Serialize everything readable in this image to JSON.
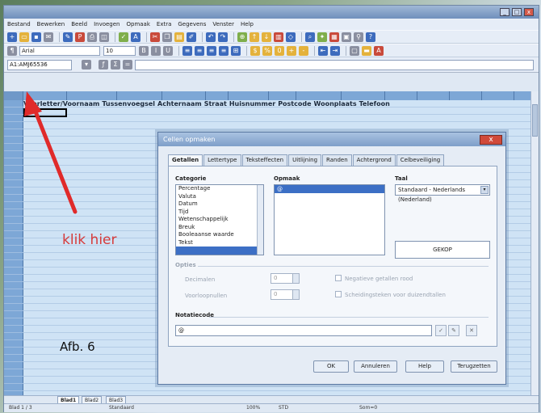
{
  "window": {
    "title": "",
    "controls": [
      "_",
      "□",
      "x"
    ]
  },
  "menu": {
    "items": [
      "Bestand",
      "Bewerken",
      "Beeld",
      "Invoegen",
      "Opmaak",
      "Extra",
      "Gegevens",
      "Venster",
      "Help"
    ]
  },
  "toolbar": {
    "font_name": "Arial",
    "font_size": "10"
  },
  "formula": {
    "name_box": "A1:AMJ65536"
  },
  "sheet": {
    "headers": [
      "Voorletter/Voornaam",
      "Tussenvoegsel",
      "Achternaam",
      "Straat",
      "Huisnummer",
      "Postcode",
      "Woonplaats",
      "Telefoon"
    ]
  },
  "annotation": {
    "click_label": "klik hier",
    "figure_label": "Afb. 6",
    "arrow_color": "#e02a2a"
  },
  "dialog": {
    "title": "Cellen opmaken",
    "tabs": [
      "Getallen",
      "Lettertype",
      "Teksteffecten",
      "Uitlijning",
      "Randen",
      "Achtergrond",
      "Celbeveiliging"
    ],
    "categorie_label": "Categorie",
    "categories": [
      "Percentage",
      "Valuta",
      "Datum",
      "Tijd",
      "Wetenschappelijk",
      "Breuk",
      "Booleaanse waarde",
      "Tekst"
    ],
    "opmaak_label": "Opmaak",
    "formats": [
      "@"
    ],
    "taal_label": "Taal",
    "taal_value": "Standaard - Nederlands (Nederland)",
    "preview": "GEKOP",
    "opties_label": "Opties",
    "decimals_label": "Decimalen",
    "decimals_value": "0",
    "leading_zeros_label": "Voorloopnullen",
    "leading_zeros_value": "0",
    "negative_red_label": "Negatieve getallen rood",
    "thousands_label": "Scheidingsteken voor duizendtallen",
    "code_label": "Notatiecode",
    "code_value": "@",
    "buttons": {
      "ok": "OK",
      "cancel": "Annuleren",
      "help": "Help",
      "reset": "Terugzetten"
    }
  },
  "sheet_tabs": [
    "Blad1",
    "Blad2",
    "Blad3"
  ],
  "status": {
    "sheet": "Blad 1 / 3",
    "style": "Standaard",
    "zoom": "100%",
    "mode": "STD",
    "sum": "Som=0"
  }
}
